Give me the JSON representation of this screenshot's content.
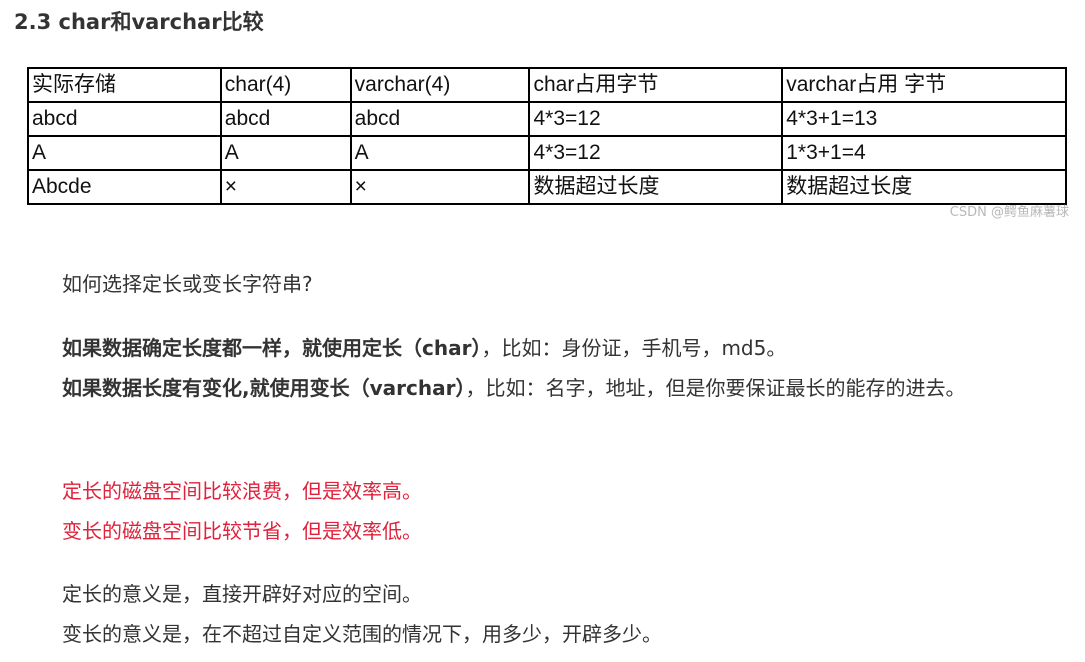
{
  "heading": "2.3 char和varchar比较",
  "table": {
    "rows": [
      [
        "实际存储",
        "char(4)",
        "varchar(4)",
        "char占用字节",
        "varchar占用 字节"
      ],
      [
        "abcd",
        "abcd",
        "abcd",
        "4*3=12",
        "4*3+1=13"
      ],
      [
        "A",
        "A",
        "A",
        "4*3=12",
        "1*3+1=4"
      ],
      [
        "Abcde",
        "×",
        "×",
        "数据超过长度",
        "数据超过长度"
      ]
    ]
  },
  "watermark": "CSDN @鳄鱼麻薯球",
  "question": "如何选择定长或变长字符串?",
  "fixed_rule": {
    "bold": "如果数据确定长度都一样，就使用定长（char）",
    "rest": "，比如：身份证，手机号，md5。"
  },
  "var_rule": {
    "bold": "如果数据长度有变化,就使用变长（varchar）",
    "rest": "，比如：名字，地址，但是你要保证最长的能存的进去。"
  },
  "red_line_1": "定长的磁盘空间比较浪费，但是效率高。",
  "red_line_2": "变长的磁盘空间比较节省，但是效率低。",
  "meaning_fixed": "定长的意义是，直接开辟好对应的空间。",
  "meaning_var": "变长的意义是，在不超过自定义范围的情况下，用多少，开辟多少。",
  "colors": {
    "text": "#333333",
    "red": "#e0223c",
    "table_border": "#000000"
  }
}
